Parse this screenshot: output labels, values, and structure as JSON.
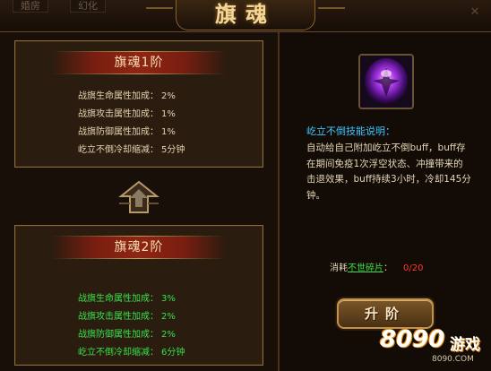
{
  "top_tabs": [
    "婚房",
    "幻化"
  ],
  "title": "旗魂",
  "stages": [
    {
      "header": "旗魂1阶",
      "attributes": [
        {
          "name": "战旗生命属性加成：",
          "value": "2%"
        },
        {
          "name": "战旗攻击属性加成：",
          "value": "1%"
        },
        {
          "name": "战旗防御属性加成：",
          "value": "1%"
        },
        {
          "name": "屹立不倒冷却缩减：",
          "value": "5分钟"
        }
      ]
    },
    {
      "header": "旗魂2阶",
      "attributes": [
        {
          "name": "战旗生命属性加成：",
          "value": "3%"
        },
        {
          "name": "战旗攻击属性加成：",
          "value": "2%"
        },
        {
          "name": "战旗防御属性加成：",
          "value": "2%"
        },
        {
          "name": "屹立不倒冷却缩减：",
          "value": "6分钟"
        }
      ]
    }
  ],
  "skill": {
    "label": "屹立不倒技能说明：",
    "description": "自动给自己附加屹立不倒buff，buff存在期间免疫1次浮空状态、冲撞带来的击退效果，buff持续3小时，冷却145分钟。"
  },
  "cost": {
    "label": "消耗",
    "item": "不世碎片",
    "separator": "：",
    "amount": "0/20"
  },
  "upgrade_button": "升阶",
  "watermark": {
    "number": "8090",
    "game": "游戏",
    "domain": "8090.COM"
  },
  "colors": {
    "stage2_text": "#38e04a",
    "skill_label": "#3fc6ff",
    "cost_amount": "#ff3a2a",
    "header_red": "#8e2514",
    "gold_border": "#8a6a3a"
  },
  "icons": [
    "close-icon",
    "up-arrow-emblem-icon",
    "purple-orb-skill-icon"
  ]
}
